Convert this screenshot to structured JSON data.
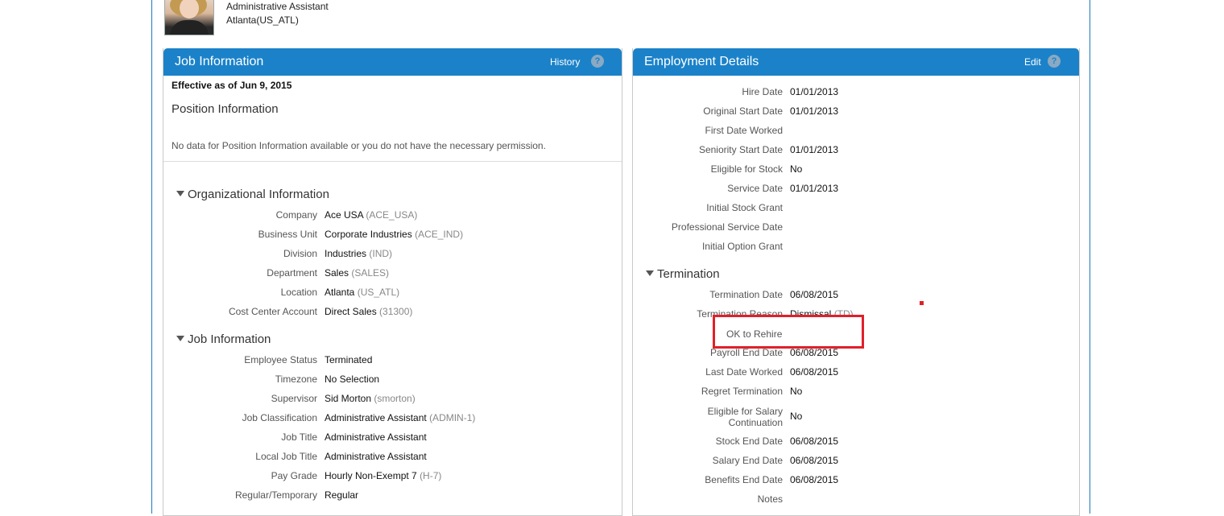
{
  "profile": {
    "title_line": "Administrative Assistant",
    "location_line": "Atlanta(US_ATL)"
  },
  "job_panel": {
    "title": "Job Information",
    "action": "History",
    "help": "?",
    "effective": "Effective as of Jun 9, 2015",
    "position_heading": "Position Information",
    "no_data": "No data for Position Information available or you do not have the necessary permission.",
    "org_heading": "Organizational Information",
    "org_rows": [
      {
        "label": "Company",
        "value": "Ace USA",
        "code": "(ACE_USA)"
      },
      {
        "label": "Business Unit",
        "value": "Corporate Industries",
        "code": "(ACE_IND)"
      },
      {
        "label": "Division",
        "value": "Industries",
        "code": "(IND)"
      },
      {
        "label": "Department",
        "value": "Sales",
        "code": "(SALES)"
      },
      {
        "label": "Location",
        "value": "Atlanta",
        "code": "(US_ATL)"
      },
      {
        "label": "Cost Center Account",
        "value": "Direct Sales",
        "code": "(31300)"
      }
    ],
    "job_heading": "Job Information",
    "job_rows": [
      {
        "label": "Employee Status",
        "value": "Terminated",
        "code": ""
      },
      {
        "label": "Timezone",
        "value": "No Selection",
        "code": ""
      },
      {
        "label": "Supervisor",
        "value": "Sid Morton",
        "code": "(smorton)"
      },
      {
        "label": "Job Classification",
        "value": "Administrative Assistant",
        "code": "(ADMIN-1)"
      },
      {
        "label": "Job Title",
        "value": "Administrative Assistant",
        "code": ""
      },
      {
        "label": "Local Job Title",
        "value": "Administrative Assistant",
        "code": ""
      },
      {
        "label": "Pay Grade",
        "value": "Hourly Non-Exempt 7",
        "code": "(H-7)"
      },
      {
        "label": "Regular/Temporary",
        "value": "Regular",
        "code": ""
      }
    ]
  },
  "emp_panel": {
    "title": "Employment Details",
    "action": "Edit",
    "help": "?",
    "detail_rows": [
      {
        "label": "Hire Date",
        "value": "01/01/2013"
      },
      {
        "label": "Original Start Date",
        "value": "01/01/2013"
      },
      {
        "label": "First Date Worked",
        "value": ""
      },
      {
        "label": "Seniority Start Date",
        "value": "01/01/2013"
      },
      {
        "label": "Eligible for Stock",
        "value": "No"
      },
      {
        "label": "Service Date",
        "value": "01/01/2013"
      },
      {
        "label": "Initial Stock Grant",
        "value": ""
      },
      {
        "label": "Professional Service Date",
        "value": ""
      },
      {
        "label": "Initial Option Grant",
        "value": ""
      }
    ],
    "termination_heading": "Termination",
    "termination_date": {
      "label": "Termination Date",
      "value": "06/08/2015"
    },
    "termination_reason": {
      "label": "Termination Reason",
      "value": "Dismissal",
      "code": "(TD)"
    },
    "ok_to_rehire_label": "OK to Rehire",
    "payroll_end": {
      "label": "Payroll End Date",
      "value": "06/08/2015"
    },
    "last_date_worked": {
      "label": "Last Date Worked",
      "value": "06/08/2015"
    },
    "regret": {
      "label": "Regret Termination",
      "value": "No"
    },
    "salary_cont": {
      "label_1": "Eligible for Salary",
      "label_2": "Continuation",
      "value": "No"
    },
    "stock_end": {
      "label": "Stock End Date",
      "value": "06/08/2015"
    },
    "salary_end": {
      "label": "Salary End Date",
      "value": "06/08/2015"
    },
    "benefits_end": {
      "label": "Benefits End Date",
      "value": "06/08/2015"
    },
    "notes": {
      "label": "Notes"
    }
  }
}
